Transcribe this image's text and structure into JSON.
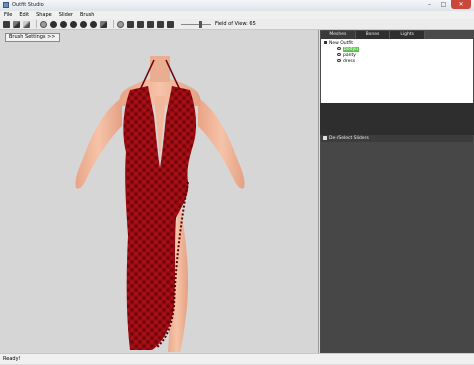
{
  "window": {
    "title": "Outfit Studio",
    "buttons": [
      "–",
      "□",
      "✕"
    ]
  },
  "menu": [
    "File",
    "Edit",
    "Shape",
    "Slider",
    "Brush"
  ],
  "toolbar": {
    "fov_label": "Field of View: 65"
  },
  "viewport": {
    "brush_settings_label": "Brush Settings >>"
  },
  "panel": {
    "tabs": [
      "Meshes",
      "Bones",
      "Lights"
    ],
    "active_tab": "Meshes",
    "tree_root": "New Outfit",
    "meshes": [
      "bodyu",
      "panty",
      "dress"
    ],
    "selected_mesh": "bodyu",
    "slider_header": "De-/Select Sliders"
  },
  "status": {
    "text": "Ready!"
  },
  "colors": {
    "dress": "#9c0a12",
    "skin": "#f0b69a",
    "viewport_bg": "#d6d6d6",
    "panel_bg": "#4a4a4a",
    "selection": "#5bc24f"
  }
}
